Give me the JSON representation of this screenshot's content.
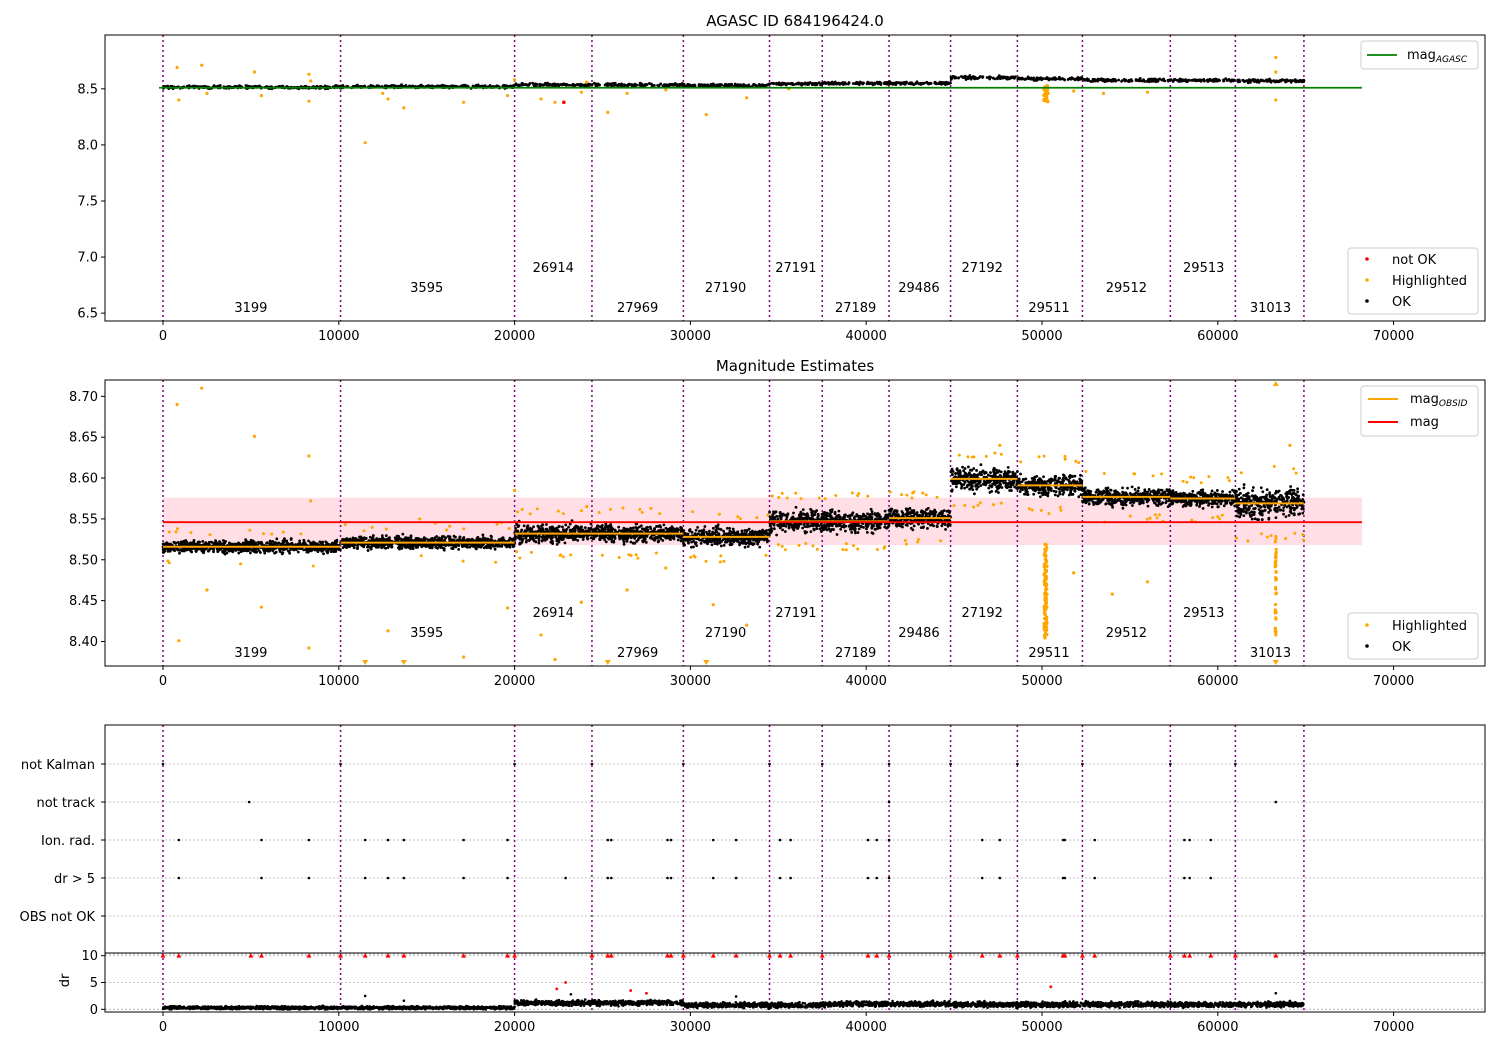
{
  "chart_data": [
    {
      "type": "scatter",
      "title": "AGASC ID 684196424.0",
      "xlim": [
        -3300,
        75200
      ],
      "ylim": [
        6.43,
        8.98
      ],
      "xticks": [
        "0",
        "10000",
        "20000",
        "30000",
        "40000",
        "50000",
        "60000",
        "70000"
      ],
      "xtick_values": [
        0,
        10000,
        20000,
        30000,
        40000,
        50000,
        60000,
        70000
      ],
      "yticks": [
        "6.5",
        "7.0",
        "7.5",
        "8.0",
        "8.5"
      ],
      "ytick_values": [
        6.5,
        7.0,
        7.5,
        8.0,
        8.5
      ],
      "mag_agasc": {
        "value": 8.51,
        "x_range": [
          0,
          68200
        ],
        "color": "#008000"
      },
      "segments": [
        {
          "x": [
            0,
            10100
          ],
          "level": 8.515
        },
        {
          "x": [
            10100,
            20000
          ],
          "level": 8.52
        },
        {
          "x": [
            20000,
            24400
          ],
          "level": 8.535
        },
        {
          "x": [
            24400,
            29600
          ],
          "level": 8.535
        },
        {
          "x": [
            29600,
            34500
          ],
          "level": 8.53
        },
        {
          "x": [
            34500,
            37500
          ],
          "level": 8.545
        },
        {
          "x": [
            37500,
            41300
          ],
          "level": 8.55
        },
        {
          "x": [
            41300,
            44800
          ],
          "level": 8.55
        },
        {
          "x": [
            44800,
            48600
          ],
          "level": 8.6
        },
        {
          "x": [
            48600,
            52300
          ],
          "level": 8.59
        },
        {
          "x": [
            52300,
            57300
          ],
          "level": 8.578
        },
        {
          "x": [
            57300,
            61000
          ],
          "level": 8.575
        },
        {
          "x": [
            61000,
            64900
          ],
          "level": 8.57
        }
      ],
      "not_ok_points": [
        {
          "x": 22800,
          "y": 8.38
        }
      ],
      "highlighted_points": [
        {
          "x": 800,
          "y": 8.69
        },
        {
          "x": 2200,
          "y": 8.71
        },
        {
          "x": 5200,
          "y": 8.65
        },
        {
          "x": 8300,
          "y": 8.63
        },
        {
          "x": 8400,
          "y": 8.57
        },
        {
          "x": 900,
          "y": 8.4
        },
        {
          "x": 2500,
          "y": 8.46
        },
        {
          "x": 5600,
          "y": 8.44
        },
        {
          "x": 8300,
          "y": 8.39
        },
        {
          "x": 11500,
          "y": 8.02
        },
        {
          "x": 12500,
          "y": 8.46
        },
        {
          "x": 13700,
          "y": 8.33
        },
        {
          "x": 12800,
          "y": 8.41
        },
        {
          "x": 17100,
          "y": 8.38
        },
        {
          "x": 19600,
          "y": 8.44
        },
        {
          "x": 21500,
          "y": 8.41
        },
        {
          "x": 22300,
          "y": 8.38
        },
        {
          "x": 23800,
          "y": 8.47
        },
        {
          "x": 25300,
          "y": 8.29
        },
        {
          "x": 26400,
          "y": 8.46
        },
        {
          "x": 28600,
          "y": 8.49
        },
        {
          "x": 30900,
          "y": 8.27
        },
        {
          "x": 33200,
          "y": 8.42
        },
        {
          "x": 35600,
          "y": 8.5
        },
        {
          "x": 51800,
          "y": 8.48
        },
        {
          "x": 53500,
          "y": 8.46
        },
        {
          "x": 56000,
          "y": 8.47
        },
        {
          "x": 63300,
          "y": 8.65
        },
        {
          "x": 63300,
          "y": 8.78
        },
        {
          "x": 63300,
          "y": 8.4
        },
        {
          "x": 20000,
          "y": 8.58
        },
        {
          "x": 24100,
          "y": 8.56
        }
      ],
      "dip_points": [
        {
          "x": 50200,
          "y": 8.38
        },
        {
          "x": 50150,
          "y": 8.41
        },
        {
          "x": 50250,
          "y": 8.44
        },
        {
          "x": 50100,
          "y": 8.47
        }
      ],
      "obsid_boundaries": [
        0,
        10100,
        20000,
        24400,
        29600,
        34500,
        37500,
        41300,
        44800,
        48600,
        52300,
        57300,
        61000,
        64900
      ],
      "obsid_labels": [
        {
          "text": "3199",
          "x": 5000,
          "row": 0
        },
        {
          "text": "3595",
          "x": 15000,
          "row": 1
        },
        {
          "text": "26914",
          "x": 22200,
          "row": 2
        },
        {
          "text": "27969",
          "x": 27000,
          "row": 0
        },
        {
          "text": "27190",
          "x": 32000,
          "row": 1
        },
        {
          "text": "27191",
          "x": 36000,
          "row": 2
        },
        {
          "text": "27189",
          "x": 39400,
          "row": 0
        },
        {
          "text": "29486",
          "x": 43000,
          "row": 1
        },
        {
          "text": "27192",
          "x": 46600,
          "row": 2
        },
        {
          "text": "29511",
          "x": 50400,
          "row": 0
        },
        {
          "text": "29512",
          "x": 54800,
          "row": 1
        },
        {
          "text": "29513",
          "x": 59200,
          "row": 2
        },
        {
          "text": "31013",
          "x": 63000,
          "row": 0
        }
      ],
      "legend_top": [
        {
          "label": "mag",
          "sub": "AGASC",
          "color": "#008000"
        }
      ],
      "legend_bottom": [
        {
          "label": "not OK",
          "color": "#ff0000"
        },
        {
          "label": "Highlighted",
          "color": "#ffa500"
        },
        {
          "label": "OK",
          "color": "#000000"
        }
      ]
    },
    {
      "type": "scatter",
      "title": "Magnitude Estimates",
      "xlim": [
        -3300,
        75200
      ],
      "ylim": [
        8.37,
        8.72
      ],
      "xticks": [
        "0",
        "10000",
        "20000",
        "30000",
        "40000",
        "50000",
        "60000",
        "70000"
      ],
      "xtick_values": [
        0,
        10000,
        20000,
        30000,
        40000,
        50000,
        60000,
        70000
      ],
      "yticks": [
        "8.40",
        "8.45",
        "8.50",
        "8.55",
        "8.60",
        "8.65",
        "8.70"
      ],
      "ytick_values": [
        8.4,
        8.45,
        8.5,
        8.55,
        8.6,
        8.65,
        8.7
      ],
      "mag": {
        "value": 8.546,
        "band": [
          8.518,
          8.576
        ],
        "x_range": [
          0,
          68200
        ],
        "color": "#ff0000"
      },
      "mag_obsid_color": "#ffa500",
      "segments": [
        {
          "x": [
            0,
            10100
          ],
          "level": 8.516,
          "spread": 0.012
        },
        {
          "x": [
            10100,
            20000
          ],
          "level": 8.521,
          "spread": 0.012
        },
        {
          "x": [
            20000,
            24400
          ],
          "level": 8.532,
          "spread": 0.018
        },
        {
          "x": [
            24400,
            29600
          ],
          "level": 8.532,
          "spread": 0.018
        },
        {
          "x": [
            29600,
            34500
          ],
          "level": 8.528,
          "spread": 0.018
        },
        {
          "x": [
            34500,
            37500
          ],
          "level": 8.547,
          "spread": 0.022
        },
        {
          "x": [
            37500,
            41300
          ],
          "level": 8.547,
          "spread": 0.022
        },
        {
          "x": [
            41300,
            44800
          ],
          "level": 8.551,
          "spread": 0.02
        },
        {
          "x": [
            44800,
            48600
          ],
          "level": 8.599,
          "spread": 0.022
        },
        {
          "x": [
            48600,
            52300
          ],
          "level": 8.591,
          "spread": 0.022
        },
        {
          "x": [
            52300,
            57300
          ],
          "level": 8.577,
          "spread": 0.018
        },
        {
          "x": [
            57300,
            61000
          ],
          "level": 8.575,
          "spread": 0.016
        },
        {
          "x": [
            61000,
            64900
          ],
          "level": 8.569,
          "spread": 0.03
        }
      ],
      "highlighted_points": [
        {
          "x": 800,
          "y": 8.69
        },
        {
          "x": 2200,
          "y": 8.71
        },
        {
          "x": 5200,
          "y": 8.651
        },
        {
          "x": 8300,
          "y": 8.627
        },
        {
          "x": 8400,
          "y": 8.572
        },
        {
          "x": 900,
          "y": 8.401
        },
        {
          "x": 2500,
          "y": 8.463
        },
        {
          "x": 5600,
          "y": 8.442
        },
        {
          "x": 8300,
          "y": 8.392
        },
        {
          "x": 12800,
          "y": 8.413
        },
        {
          "x": 14600,
          "y": 8.55
        },
        {
          "x": 17100,
          "y": 8.381
        },
        {
          "x": 19600,
          "y": 8.441
        },
        {
          "x": 21500,
          "y": 8.408
        },
        {
          "x": 22300,
          "y": 8.378
        },
        {
          "x": 23800,
          "y": 8.448
        },
        {
          "x": 26400,
          "y": 8.463
        },
        {
          "x": 28600,
          "y": 8.49
        },
        {
          "x": 31300,
          "y": 8.445
        },
        {
          "x": 33200,
          "y": 8.42
        },
        {
          "x": 51800,
          "y": 8.484
        },
        {
          "x": 54000,
          "y": 8.458
        },
        {
          "x": 56000,
          "y": 8.473
        },
        {
          "x": 63300,
          "y": 8.408
        },
        {
          "x": 20000,
          "y": 8.585
        },
        {
          "x": 24100,
          "y": 8.565
        },
        {
          "x": 47600,
          "y": 8.64
        },
        {
          "x": 64100,
          "y": 8.64
        }
      ],
      "highlighted_clip_low": [
        {
          "x": 11500
        },
        {
          "x": 13700
        },
        {
          "x": 25300
        },
        {
          "x": 30900
        },
        {
          "x": 63300
        }
      ],
      "highlighted_clip_high": [
        {
          "x": 63300
        }
      ],
      "dip": {
        "x": 50200,
        "y_top": 8.52,
        "y_bottom": 8.4
      },
      "obsid_boundaries": [
        0,
        10100,
        20000,
        24400,
        29600,
        34500,
        37500,
        41300,
        44800,
        48600,
        52300,
        57300,
        61000,
        64900
      ],
      "obsid_labels": [
        {
          "text": "3199",
          "x": 5000,
          "row": 0
        },
        {
          "text": "3595",
          "x": 15000,
          "row": 1
        },
        {
          "text": "26914",
          "x": 22200,
          "row": 2
        },
        {
          "text": "27969",
          "x": 27000,
          "row": 0
        },
        {
          "text": "27190",
          "x": 32000,
          "row": 1
        },
        {
          "text": "27191",
          "x": 36000,
          "row": 2
        },
        {
          "text": "27189",
          "x": 39400,
          "row": 0
        },
        {
          "text": "29486",
          "x": 43000,
          "row": 1
        },
        {
          "text": "27192",
          "x": 46600,
          "row": 2
        },
        {
          "text": "29511",
          "x": 50400,
          "row": 0
        },
        {
          "text": "29512",
          "x": 54800,
          "row": 1
        },
        {
          "text": "29513",
          "x": 59200,
          "row": 2
        },
        {
          "text": "31013",
          "x": 63000,
          "row": 0
        }
      ],
      "legend_top": [
        {
          "label": "mag",
          "sub": "OBSID",
          "color": "#ffa500"
        },
        {
          "label": "mag",
          "sub": "",
          "color": "#ff0000"
        }
      ],
      "legend_bottom": [
        {
          "label": "Highlighted",
          "color": "#ffa500"
        },
        {
          "label": "OK",
          "color": "#000000"
        }
      ]
    },
    {
      "type": "scatter",
      "title": "",
      "xlim": [
        -3300,
        75200
      ],
      "categories": [
        "not Kalman",
        "not track",
        "Ion. rad.",
        "dr > 5",
        "OBS not OK"
      ],
      "flags": {
        "not Kalman": [
          0,
          10100,
          20000,
          24400,
          29600,
          34500,
          37500,
          41300,
          44800,
          48600,
          52300,
          57300,
          61000
        ],
        "not track": [
          4900,
          41300,
          63300
        ],
        "Ion. rad.": [
          900,
          5600,
          8300,
          11500,
          12800,
          13700,
          17100,
          19600,
          25300,
          25500,
          28700,
          28900,
          31300,
          32600,
          35100,
          35700,
          40100,
          40600,
          41300,
          46600,
          47600,
          51200,
          51300,
          53000,
          58100,
          58400,
          59600
        ],
        "dr > 5": [
          900,
          5600,
          8300,
          11500,
          12800,
          13700,
          17100,
          19600,
          22900,
          25300,
          25500,
          28700,
          28900,
          31300,
          32600,
          35100,
          35700,
          40100,
          40600,
          41300,
          46600,
          47600,
          51200,
          51300,
          53000,
          58100,
          58400,
          59600
        ],
        "OBS not OK": []
      }
    },
    {
      "type": "scatter",
      "title": "",
      "ylabel": "dr",
      "xlim": [
        -3300,
        75200
      ],
      "ylim": [
        -0.5,
        10.5
      ],
      "xticks": [
        "0",
        "10000",
        "20000",
        "30000",
        "40000",
        "50000",
        "60000",
        "70000"
      ],
      "xtick_values": [
        0,
        10000,
        20000,
        30000,
        40000,
        50000,
        60000,
        70000
      ],
      "yticks": [
        "0",
        "5",
        "10"
      ],
      "ytick_values": [
        0,
        5,
        10
      ],
      "segments": [
        {
          "x": [
            0,
            20000
          ],
          "level": 0.3,
          "spread": 0.3
        },
        {
          "x": [
            20000,
            29600
          ],
          "level": 1.2,
          "spread": 0.5
        },
        {
          "x": [
            29600,
            37500
          ],
          "level": 0.8,
          "spread": 0.5
        },
        {
          "x": [
            37500,
            44800
          ],
          "level": 1.0,
          "spread": 0.5
        },
        {
          "x": [
            44800,
            64900
          ],
          "level": 0.9,
          "spread": 0.5
        }
      ],
      "clipped_high": [
        0,
        900,
        5000,
        5600,
        8300,
        10100,
        11500,
        12800,
        13700,
        17100,
        19600,
        20000,
        24400,
        25300,
        25500,
        28700,
        28900,
        29600,
        31300,
        32600,
        34500,
        35100,
        35700,
        37500,
        40100,
        40600,
        41300,
        44800,
        46600,
        47600,
        48600,
        51200,
        51300,
        52300,
        53000,
        57300,
        58100,
        58400,
        59600,
        61000,
        63300
      ],
      "red_points": [
        {
          "x": 22400,
          "y": 3.8
        },
        {
          "x": 22900,
          "y": 5.0
        },
        {
          "x": 26600,
          "y": 3.5
        },
        {
          "x": 50500,
          "y": 4.2
        },
        {
          "x": 27500,
          "y": 3.0
        }
      ],
      "black_points": [
        {
          "x": 11500,
          "y": 2.5
        },
        {
          "x": 13700,
          "y": 1.6
        },
        {
          "x": 23200,
          "y": 2.8
        },
        {
          "x": 32600,
          "y": 2.4
        },
        {
          "x": 63300,
          "y": 3.0
        }
      ]
    }
  ]
}
